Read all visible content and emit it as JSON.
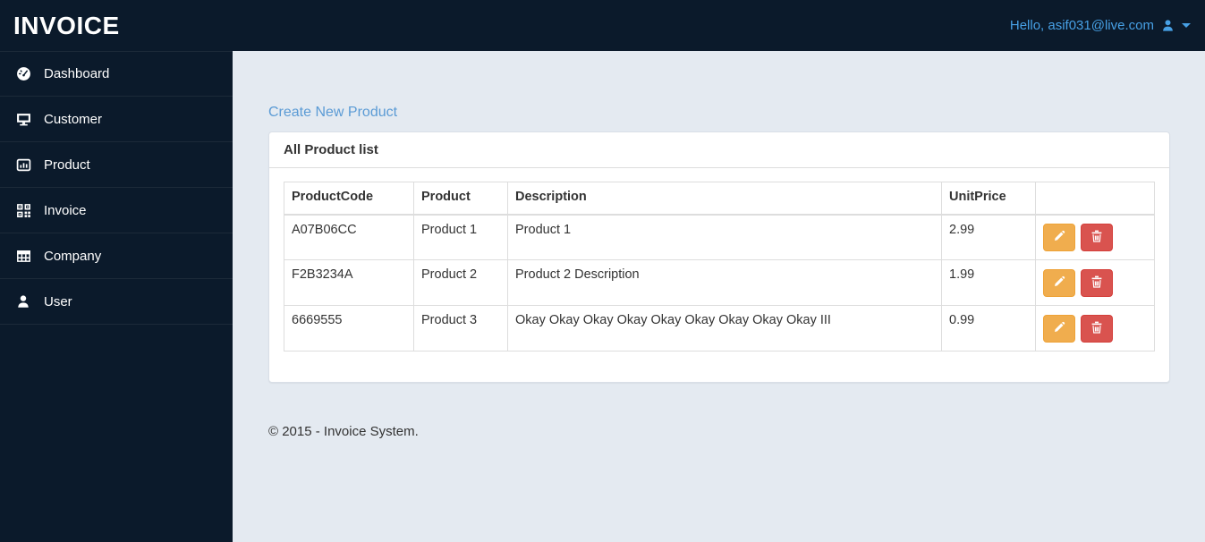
{
  "navbar": {
    "brand": "INVOICE",
    "user_greeting": "Hello, asif031@live.com"
  },
  "sidebar": {
    "items": [
      {
        "label": "Dashboard",
        "icon": "dashboard-gauge-icon"
      },
      {
        "label": "Customer",
        "icon": "desktop-icon"
      },
      {
        "label": "Product",
        "icon": "bar-chart-icon"
      },
      {
        "label": "Invoice",
        "icon": "qrcode-icon"
      },
      {
        "label": "Company",
        "icon": "table-grid-icon"
      },
      {
        "label": "User",
        "icon": "user-icon"
      }
    ]
  },
  "main": {
    "create_link": "Create New Product",
    "panel_title": "All Product list",
    "table": {
      "headers": [
        "ProductCode",
        "Product",
        "Description",
        "UnitPrice",
        ""
      ],
      "rows": [
        {
          "code": "A07B06CC",
          "product": "Product 1",
          "description": "Product 1",
          "unit_price": "2.99"
        },
        {
          "code": "F2B3234A",
          "product": "Product 2",
          "description": "Product 2 Description",
          "unit_price": "1.99"
        },
        {
          "code": "6669555",
          "product": "Product 3",
          "description": "Okay Okay Okay Okay Okay Okay Okay Okay Okay III",
          "unit_price": "0.99"
        }
      ],
      "action_icons": {
        "edit": "pencil-icon",
        "delete": "trash-icon"
      }
    },
    "footer": "© 2015 - Invoice System."
  },
  "colors": {
    "navbar_bg": "#0b1a2b",
    "sidebar_bg": "#0b1a2b",
    "content_bg": "#e4eaf1",
    "link_blue": "#5b9bd5",
    "navbar_link_blue": "#47a0e5",
    "warning_orange": "#f0ad4e",
    "danger_red": "#d9534f",
    "table_border": "#dddddd",
    "text": "#333333"
  }
}
